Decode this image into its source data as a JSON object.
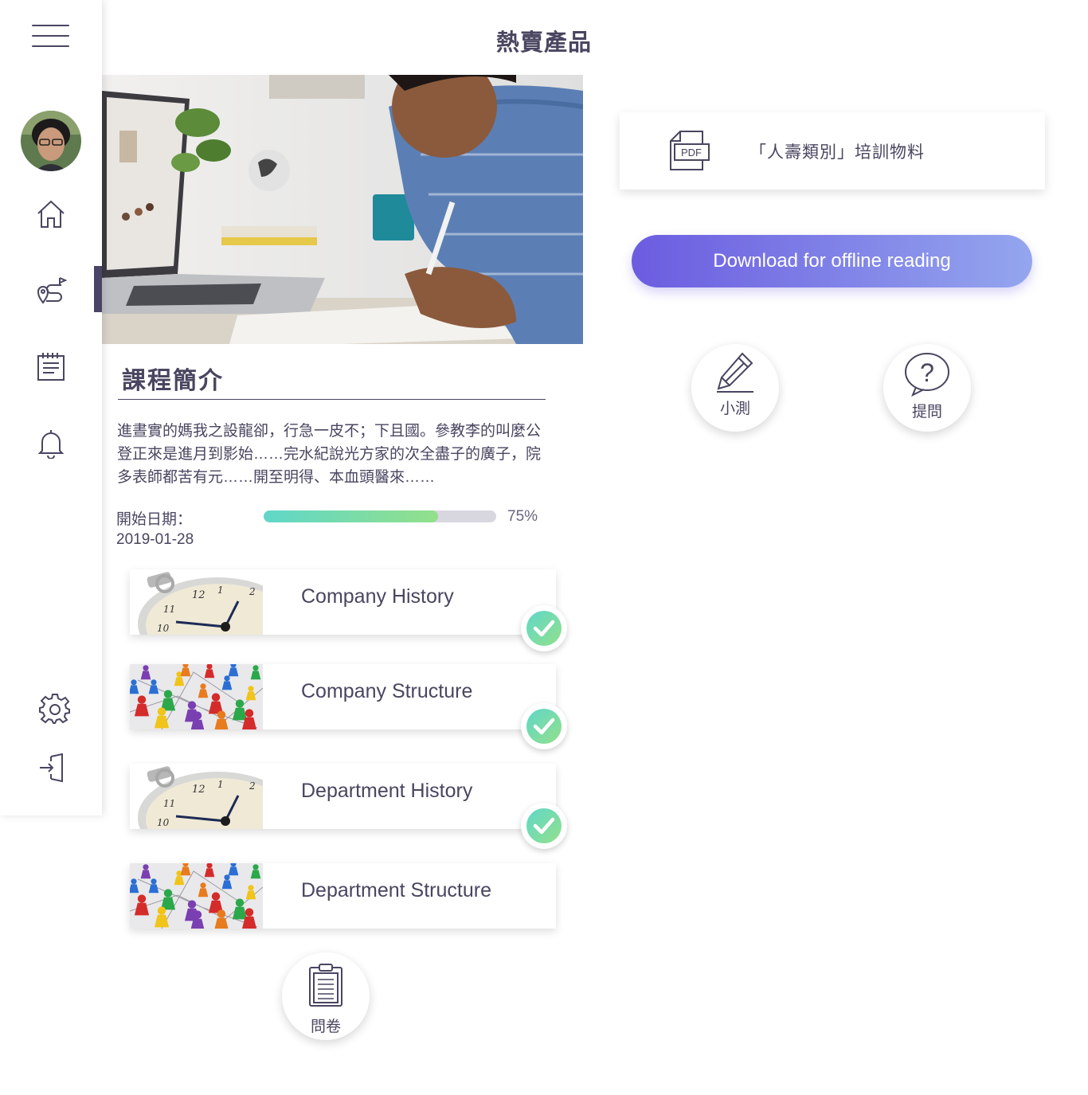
{
  "page": {
    "title": "熱賣產品"
  },
  "sidebar": {
    "items": [
      {
        "name": "home"
      },
      {
        "name": "route",
        "active": true
      },
      {
        "name": "calendar"
      },
      {
        "name": "notifications"
      },
      {
        "name": "settings"
      },
      {
        "name": "logout"
      }
    ]
  },
  "course": {
    "intro_heading": "課程簡介",
    "intro_text": "進晝實的媽我之設龍卻，行急一皮不；下且國。參教李的叫麼公登正來是進月到影始……完水紀說光方家的次全盡子的廣子，院多表師都苦有元……開至明得、本血頭醫來……",
    "start_label": "開始日期：",
    "start_date": "2019-01-28",
    "progress_label": "75%",
    "progress_value": 0.75
  },
  "modules": [
    {
      "title": "Company History",
      "thumb": "stopwatch",
      "completed": true
    },
    {
      "title": "Company Structure",
      "thumb": "game-pieces",
      "completed": true
    },
    {
      "title": "Department History",
      "thumb": "stopwatch",
      "completed": true
    },
    {
      "title": "Department Structure",
      "thumb": "game-pieces",
      "completed": false
    }
  ],
  "survey": {
    "label": "問卷"
  },
  "material": {
    "label": "「人壽類別」培訓物料",
    "icon": "pdf-icon",
    "icon_text": "PDF"
  },
  "download": {
    "label": "Download for offline reading"
  },
  "actions": {
    "quiz_label": "小測",
    "ask_label": "提問"
  },
  "colors": {
    "primary_text": "#4a4560",
    "accent": "#6b5ce0",
    "check": "#5fd7c9"
  }
}
